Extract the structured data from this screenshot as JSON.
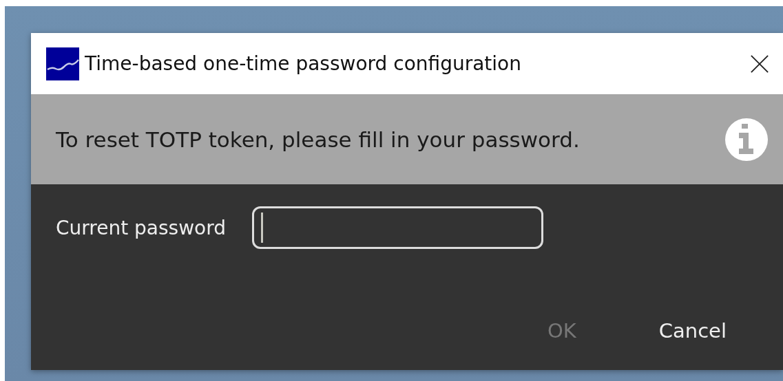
{
  "window": {
    "title": "Time-based one-time password configuration"
  },
  "banner": {
    "message": "To reset TOTP token, please fill in your password."
  },
  "form": {
    "fields": [
      {
        "label": "Current password",
        "focused": true
      }
    ]
  },
  "buttons": [
    {
      "label": "OK",
      "disabled": true
    },
    {
      "label": "Cancel",
      "disabled": false
    }
  ]
}
